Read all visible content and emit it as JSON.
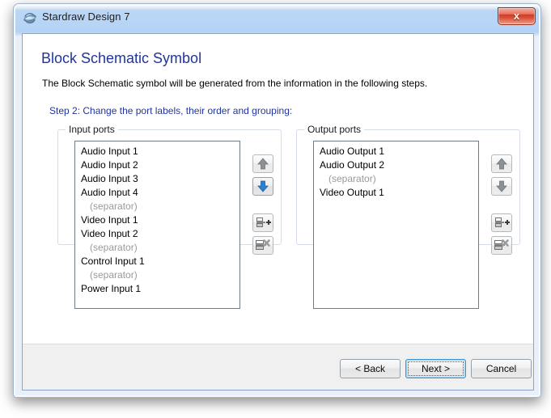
{
  "window": {
    "title": "Stardraw Design 7",
    "app_icon": "globe-icon",
    "close_label": "x"
  },
  "page": {
    "title": "Block Schematic Symbol",
    "subtitle": "The Block Schematic symbol will be generated from the information in the following steps.",
    "step_label": "Step 2: Change the port labels, their order and grouping:",
    "title_color": "#20359c"
  },
  "input_group": {
    "title": "Input ports",
    "items": [
      {
        "label": "Audio Input 1",
        "type": "port"
      },
      {
        "label": "Audio Input 2",
        "type": "port"
      },
      {
        "label": "Audio Input 3",
        "type": "port"
      },
      {
        "label": "Audio Input 4",
        "type": "port"
      },
      {
        "label": "(separator)",
        "type": "separator"
      },
      {
        "label": "Video Input 1",
        "type": "port"
      },
      {
        "label": "Video Input 2",
        "type": "port"
      },
      {
        "label": "(separator)",
        "type": "separator"
      },
      {
        "label": "Control Input 1",
        "type": "port"
      },
      {
        "label": "(separator)",
        "type": "separator"
      },
      {
        "label": "Power Input 1",
        "type": "port"
      }
    ],
    "buttons": {
      "move_up": {
        "icon": "arrow-up-icon",
        "enabled": false,
        "color": "#8c9196"
      },
      "move_down": {
        "icon": "arrow-down-icon",
        "enabled": true,
        "color": "#2f7fd0"
      },
      "add_separator": {
        "icon": "add-separator-icon",
        "enabled": true,
        "color": "#6f6f6f"
      },
      "remove_separator": {
        "icon": "remove-separator-icon",
        "enabled": true,
        "color": "#6f6f6f"
      }
    }
  },
  "output_group": {
    "title": "Output ports",
    "items": [
      {
        "label": "Audio Output 1",
        "type": "port"
      },
      {
        "label": "Audio Output 2",
        "type": "port"
      },
      {
        "label": "(separator)",
        "type": "separator"
      },
      {
        "label": "Video Output 1",
        "type": "port"
      }
    ],
    "buttons": {
      "move_up": {
        "icon": "arrow-up-icon",
        "enabled": false,
        "color": "#8c9196"
      },
      "move_down": {
        "icon": "arrow-down-icon",
        "enabled": false,
        "color": "#8c9196"
      },
      "add_separator": {
        "icon": "add-separator-icon",
        "enabled": true,
        "color": "#6f6f6f"
      },
      "remove_separator": {
        "icon": "remove-separator-icon",
        "enabled": true,
        "color": "#6f6f6f"
      }
    }
  },
  "footer": {
    "back_label": "< Back",
    "next_label": "Next >",
    "cancel_label": "Cancel",
    "focused_button": "next",
    "focus_color": "#3c97d4"
  }
}
